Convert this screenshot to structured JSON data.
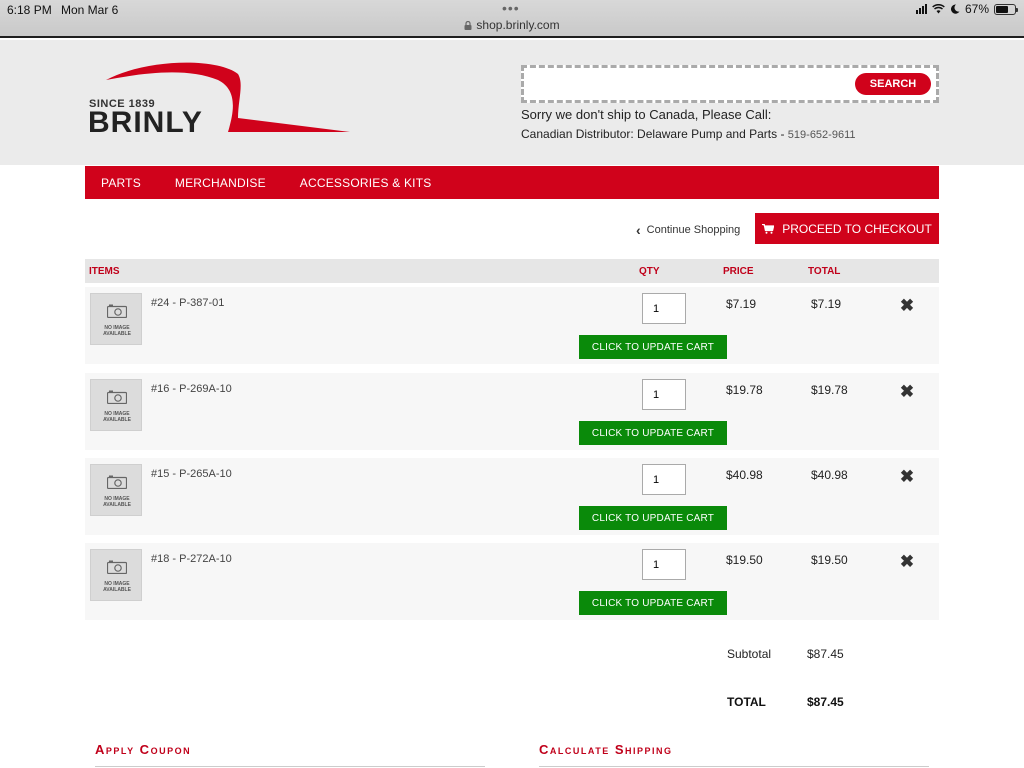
{
  "status_bar": {
    "time": "6:18 PM",
    "date": "Mon Mar 6",
    "dots": "•••",
    "url": "shop.brinly.com",
    "battery": "67%",
    "battery_level": 0.67
  },
  "header": {
    "logo_since": "SINCE 1839",
    "logo_brand": "BRINLY",
    "search_placeholder": "",
    "search_button": "SEARCH",
    "notice_line1": "Sorry we don't ship to Canada, Please Call:",
    "notice_line2": "Canadian Distributor: Delaware Pump and Parts - ",
    "notice_phone": "519-652-9611"
  },
  "nav": {
    "items": [
      "PARTS",
      "MERCHANDISE",
      "ACCESSORIES & KITS"
    ]
  },
  "actions": {
    "continue_shopping": "Continue Shopping",
    "checkout": "PROCEED TO CHECKOUT"
  },
  "table": {
    "col_items": "ITEMS",
    "col_qty": "QTY",
    "col_price": "PRICE",
    "col_total": "TOTAL",
    "no_image_line1": "NO IMAGE",
    "no_image_line2": "AVAILABLE",
    "update_label": "CLICK TO UPDATE CART",
    "rows": [
      {
        "name": "#24 - P-387-01",
        "qty": "1",
        "price": "$7.19",
        "total": "$7.19"
      },
      {
        "name": "#16 - P-269A-10",
        "qty": "1",
        "price": "$19.78",
        "total": "$19.78"
      },
      {
        "name": "#15 - P-265A-10",
        "qty": "1",
        "price": "$40.98",
        "total": "$40.98"
      },
      {
        "name": "#18 - P-272A-10",
        "qty": "1",
        "price": "$19.50",
        "total": "$19.50"
      }
    ]
  },
  "totals": {
    "subtotal_label": "Subtotal",
    "subtotal_value": "$87.45",
    "total_label": "TOTAL",
    "total_value": "$87.45"
  },
  "sections": {
    "coupon": "Apply Coupon",
    "shipping": "Calculate Shipping"
  },
  "colors": {
    "brand_red": "#d0021b",
    "update_green": "#0a8a0a",
    "header_bg": "#ebebeb"
  }
}
